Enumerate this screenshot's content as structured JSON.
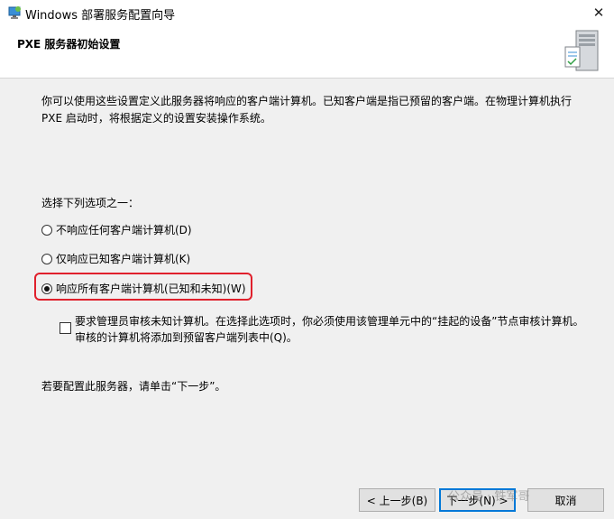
{
  "window": {
    "title": "Windows 部署服务配置向导",
    "close_glyph": "✕"
  },
  "header": {
    "title": "PXE 服务器初始设置"
  },
  "intro": {
    "line1": "你可以使用这些设置定义此服务器将响应的客户端计算机。已知客户端是指已预留的客户端。在物理计算机执行",
    "line2": "PXE 启动时，将根据定义的设置安装操作系统。"
  },
  "options": {
    "prompt": "选择下列选项之一：",
    "items": [
      {
        "label": "不响应任何客户端计算机(D)",
        "checked": false
      },
      {
        "label": "仅响应已知客户端计算机(K)",
        "checked": false
      },
      {
        "label": "响应所有客户端计算机(已知和未知)(W)",
        "checked": true
      }
    ]
  },
  "approval": {
    "checked": false,
    "line1": "要求管理员审核未知计算机。在选择此选项时，你必须使用该管理单元中的“挂起的设备”节点审核计算机。",
    "line2": "审核的计算机将添加到预留客户端列表中(Q)。"
  },
  "footer_text": "若要配置此服务器，请单击“下一步”。",
  "buttons": {
    "back": "< 上一步(B)",
    "next": "下一步(N) >",
    "cancel": "取消"
  },
  "watermark": "公众号 · 铁军哥",
  "colors": {
    "highlight": "#e0202c",
    "primary_border": "#0078d7"
  }
}
